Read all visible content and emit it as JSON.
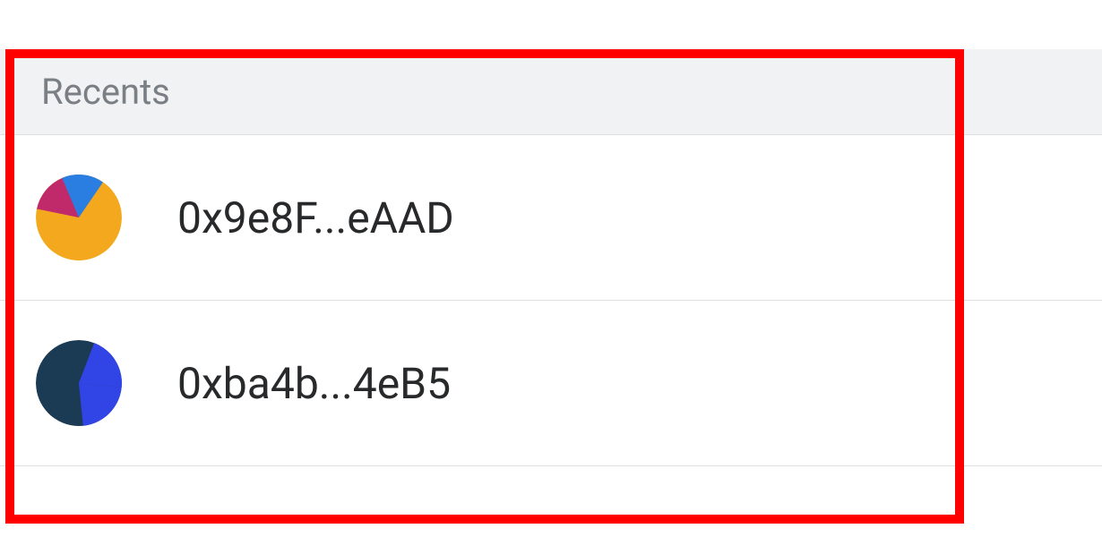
{
  "recents": {
    "header_label": "Recents",
    "items": [
      {
        "address": "0x9e8F...eAAD",
        "avatar_colors": {
          "c1": "#f4a81d",
          "c2": "#2a7de1",
          "c3": "#c12a6a"
        }
      },
      {
        "address": "0xba4b...4eB5",
        "avatar_colors": {
          "c1": "#1b3b54",
          "c2": "#3145e6",
          "c3": "#223a55"
        }
      }
    ]
  }
}
